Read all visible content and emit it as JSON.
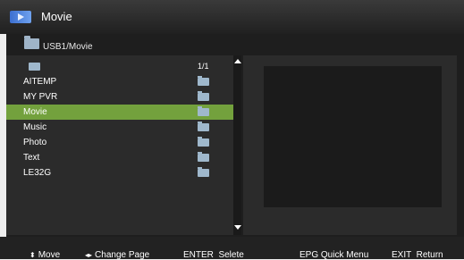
{
  "header": {
    "icon": "movie-icon",
    "title": "Movie"
  },
  "path": {
    "icon": "folder-icon",
    "label": "USB1/Movie"
  },
  "list": {
    "page_indicator": "1/1",
    "items": [
      {
        "label": "AITEMP",
        "icon": "folder-icon",
        "selected": false
      },
      {
        "label": "MY PVR",
        "icon": "folder-icon",
        "selected": false
      },
      {
        "label": "Movie",
        "icon": "folder-icon",
        "selected": true
      },
      {
        "label": "Music",
        "icon": "folder-icon",
        "selected": false
      },
      {
        "label": "Photo",
        "icon": "folder-icon",
        "selected": false
      },
      {
        "label": "Text",
        "icon": "folder-icon",
        "selected": false
      },
      {
        "label": "LE32G",
        "icon": "folder-icon",
        "selected": false
      }
    ]
  },
  "help": {
    "move": "Move",
    "change_page": "Change Page",
    "enter": "ENTER  Selete",
    "epg": "EPG Quick Menu",
    "exit": "EXIT  Return"
  },
  "colors": {
    "selection": "#73a13d",
    "list_background": "#2b2b2b",
    "title_bar": "#2a2a2a",
    "folder_icon": "#9fb8cc"
  }
}
